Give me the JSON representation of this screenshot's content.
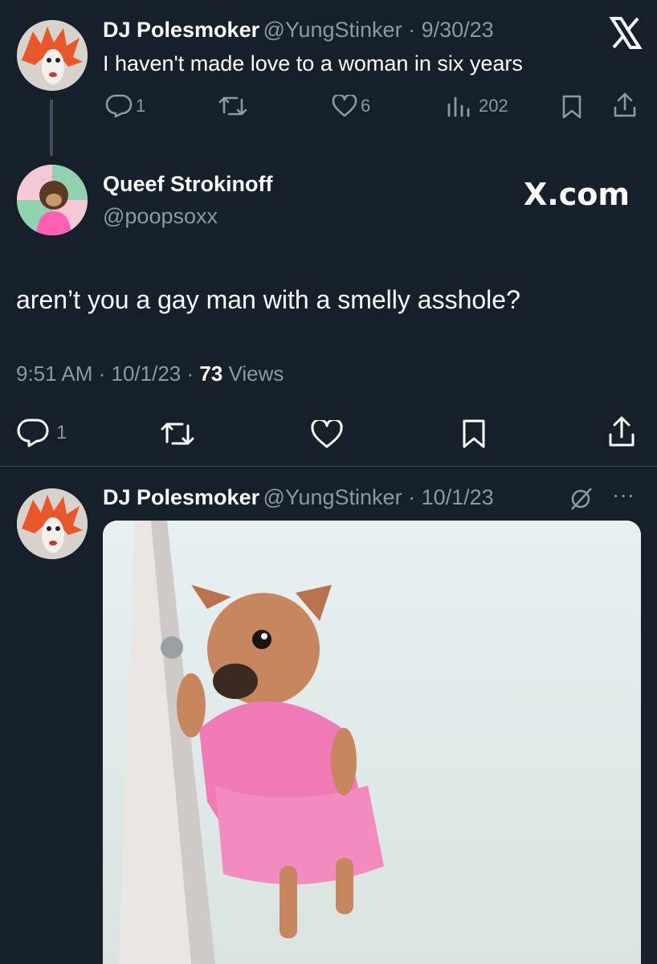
{
  "tweet1": {
    "author": "DJ Polesmoker",
    "handle": "@YungStinker",
    "date": "9/30/23",
    "text": "I haven't made love to a woman in six years",
    "replies": "1",
    "likes": "6",
    "views": "202",
    "platform_logo": "X"
  },
  "tweet2": {
    "author": "Queef Strokinoff",
    "handle": "@poopsoxx",
    "brand": "X.com",
    "text": "aren’t you a gay man with a smelly asshole?",
    "time": "9:51 AM",
    "date": "10/1/23",
    "views_count": "73",
    "views_label": "Views",
    "replies": "1"
  },
  "tweet3": {
    "author": "DJ Polesmoker",
    "handle": "@YungStinker",
    "date": "10/1/23",
    "more": "···"
  },
  "separator": " · ",
  "colors": {
    "background": "#15202b",
    "muted": "#8b98a5",
    "divider": "#38444d"
  },
  "icons": [
    "reply-icon",
    "retweet-icon",
    "like-icon",
    "views-icon",
    "bookmark-icon",
    "share-icon",
    "grok-icon",
    "more-icon"
  ]
}
